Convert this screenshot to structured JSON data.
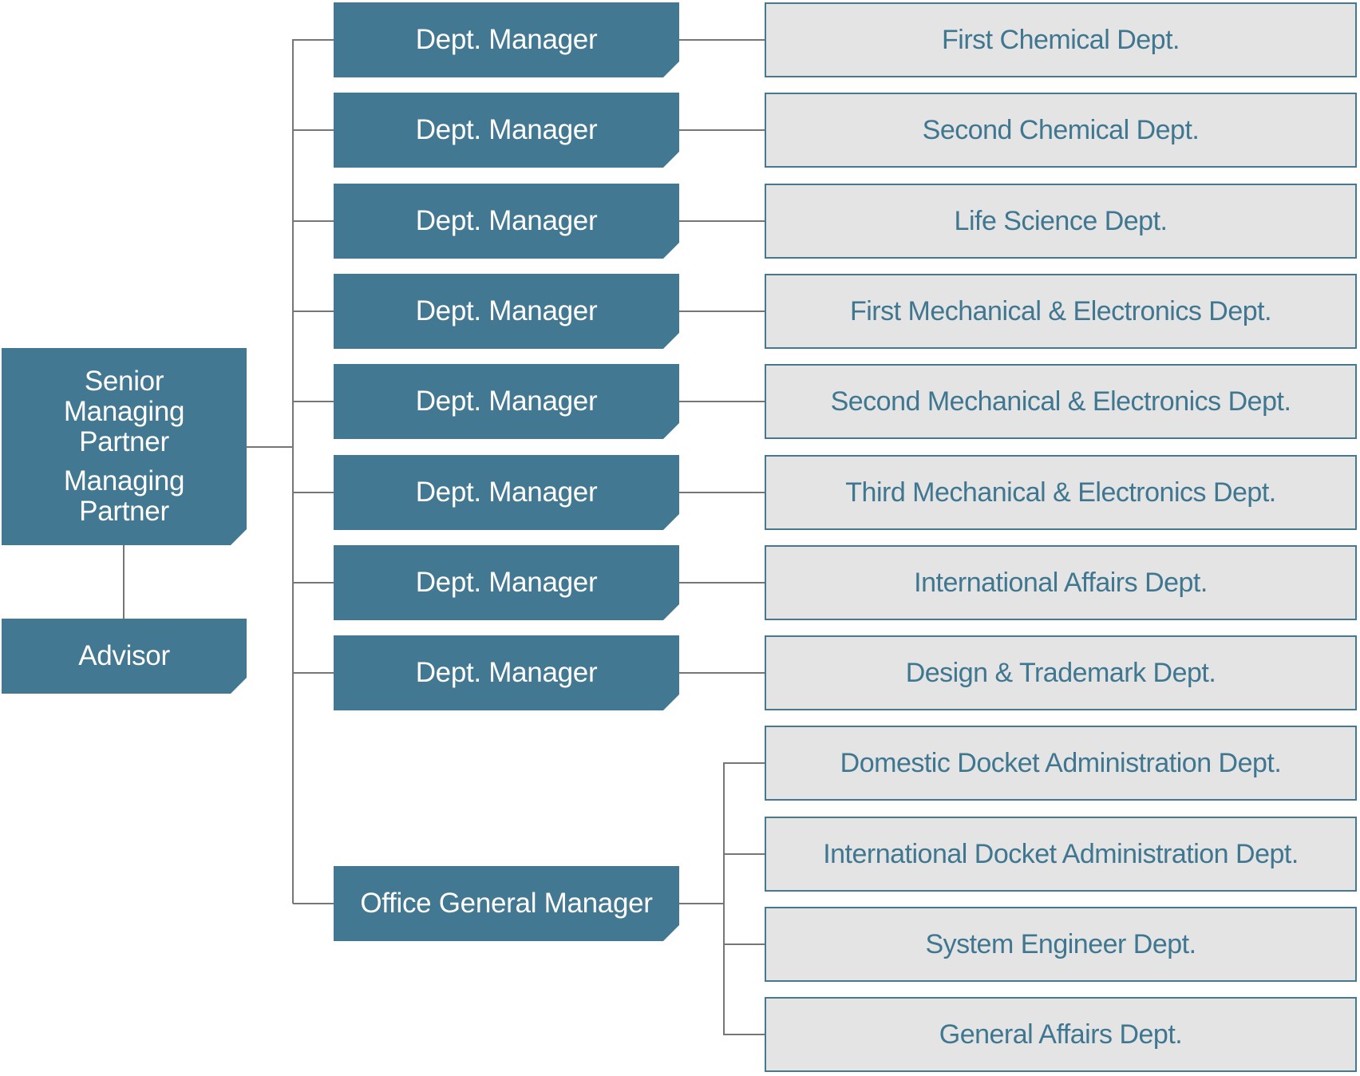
{
  "chart": {
    "title": "",
    "root": {
      "lines": [
        "Senior Managing Partner",
        "Managing Partner"
      ]
    },
    "advisor": "Advisor",
    "managers": [
      {
        "label": "Dept. Manager",
        "departments": [
          "First Chemical Dept."
        ]
      },
      {
        "label": "Dept. Manager",
        "departments": [
          "Second Chemical Dept."
        ]
      },
      {
        "label": "Dept. Manager",
        "departments": [
          "Life Science Dept."
        ]
      },
      {
        "label": "Dept. Manager",
        "departments": [
          "First Mechanical & Electronics Dept."
        ]
      },
      {
        "label": "Dept. Manager",
        "departments": [
          "Second Mechanical & Electronics Dept."
        ]
      },
      {
        "label": "Dept. Manager",
        "departments": [
          "Third Mechanical & Electronics Dept."
        ]
      },
      {
        "label": "Dept. Manager",
        "departments": [
          "International Affairs Dept."
        ]
      },
      {
        "label": "Dept. Manager",
        "departments": [
          "Design & Trademark Dept."
        ]
      },
      {
        "label": "Office General Manager",
        "departments": [
          "Domestic Docket Administration Dept.",
          "International Docket Administration Dept.",
          "System Engineer Dept.",
          "General Affairs Dept."
        ]
      }
    ]
  },
  "colors": {
    "node_dark": "#427891",
    "node_light_bg": "#e4e4e4",
    "node_light_text": "#3f7690",
    "connector": "#767676"
  }
}
